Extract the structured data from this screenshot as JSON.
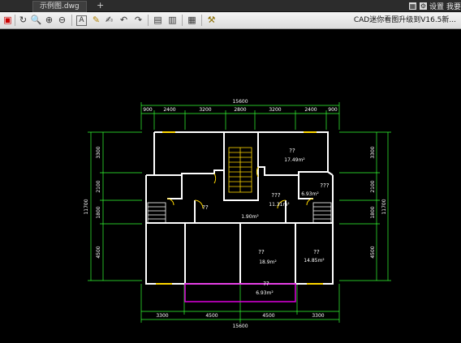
{
  "window": {
    "tab_label": "示例图.dwg",
    "tab_add": "+",
    "right_labels": [
      "设置",
      "我要"
    ],
    "app_title": "CAD迷你看图升级到V16.5新..."
  },
  "toolbar": {
    "icons": [
      "app-logo-icon",
      "refresh-icon",
      "zoom-in-icon",
      "zoom-window-icon",
      "zoom-out-icon",
      "text-icon",
      "pencil-icon",
      "markup-icon",
      "undo-icon",
      "redo-icon",
      "layer-icon",
      "print-icon",
      "layout-icon",
      "settings-icon"
    ]
  },
  "drawing": {
    "top_total": "15600",
    "top_dims": [
      "900",
      "2400",
      "3200",
      "2800",
      "3200",
      "2400",
      "900"
    ],
    "bottom_total": "15600",
    "bottom_dims": [
      "3300",
      "4500",
      "4500",
      "3300"
    ],
    "left_total": "11700",
    "left_dims": [
      "3300",
      "2100",
      "1800",
      "4500"
    ],
    "right_total": "11700",
    "right_dims": [
      "3300",
      "2100",
      "1800",
      "4500"
    ],
    "rooms": [
      {
        "name": "??",
        "area": "17.49m²"
      },
      {
        "name": "???",
        "area": "11.31m²"
      },
      {
        "name": "???",
        "area": "6.93m²"
      },
      {
        "name": "??",
        "area": "1.90m²"
      },
      {
        "name": "??",
        "area": "18.9m²"
      },
      {
        "name": "??",
        "area": "14.85m²"
      },
      {
        "name": "??",
        "area": "6.93m²"
      },
      {
        "name": "??",
        "area": ""
      }
    ]
  }
}
